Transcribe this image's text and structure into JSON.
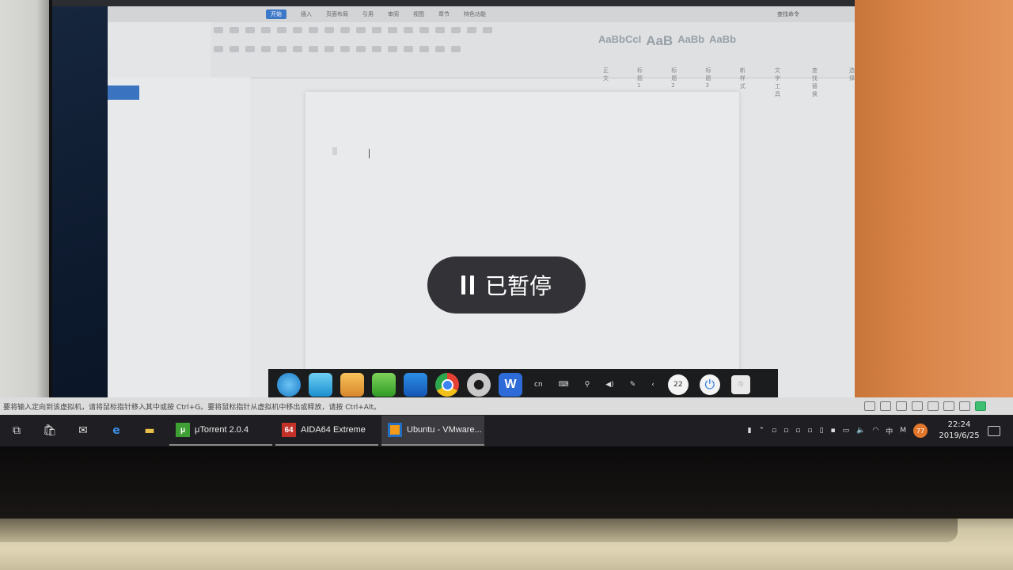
{
  "vm_window": {
    "menu": [
      "开始",
      "插入",
      "页面布局",
      "引用",
      "审阅",
      "视图",
      "章节",
      "特色功能"
    ],
    "active_menu_index": 0,
    "search_label": "查找命令"
  },
  "ribbon": {
    "style_samples": [
      "AaBbCcI",
      "AaB",
      "AaBb",
      "AaBb"
    ],
    "style_samples_row2": [
      "AaBbCc",
      "AaB",
      "AaBb",
      "AaBb"
    ],
    "style_labels": [
      "正文",
      "标题1",
      "标题2",
      "标题3"
    ],
    "right_labels": [
      "新样式",
      "文字工具",
      "查找替换",
      "选择"
    ]
  },
  "dock": {
    "apps": [
      "launcher",
      "app-store",
      "file-manager",
      "ebook-reader",
      "video-player",
      "chrome",
      "control-center",
      "wps-writer"
    ],
    "wps_letter": "W",
    "tray_lang": "cn",
    "clock_text": "22",
    "power_glyph": "⏻"
  },
  "vm_statusbar": {
    "hint": "要将输入定向到该虚拟机，请将鼠标指针移入其中或按 Ctrl+G。要将鼠标指针从虚拟机中移出或释放，请按 Ctrl+Alt。"
  },
  "taskbar": {
    "tasks": [
      {
        "icon": "μ",
        "label": "μTorrent 2.0.4"
      },
      {
        "icon": "64",
        "label": "AIDA64 Extreme"
      },
      {
        "icon": "",
        "label": "Ubuntu - VMware..."
      }
    ],
    "tray_ime_label": "中",
    "tray_ime_mode": "M",
    "tray_badge": "77",
    "time": "22:24",
    "date": "2019/6/25"
  },
  "pause_overlay": {
    "label": "已暂停"
  },
  "colors": {
    "accent_blue": "#2c6bd8",
    "toast_bg": "#26262c",
    "taskbar_bg": "#1f1f23"
  }
}
